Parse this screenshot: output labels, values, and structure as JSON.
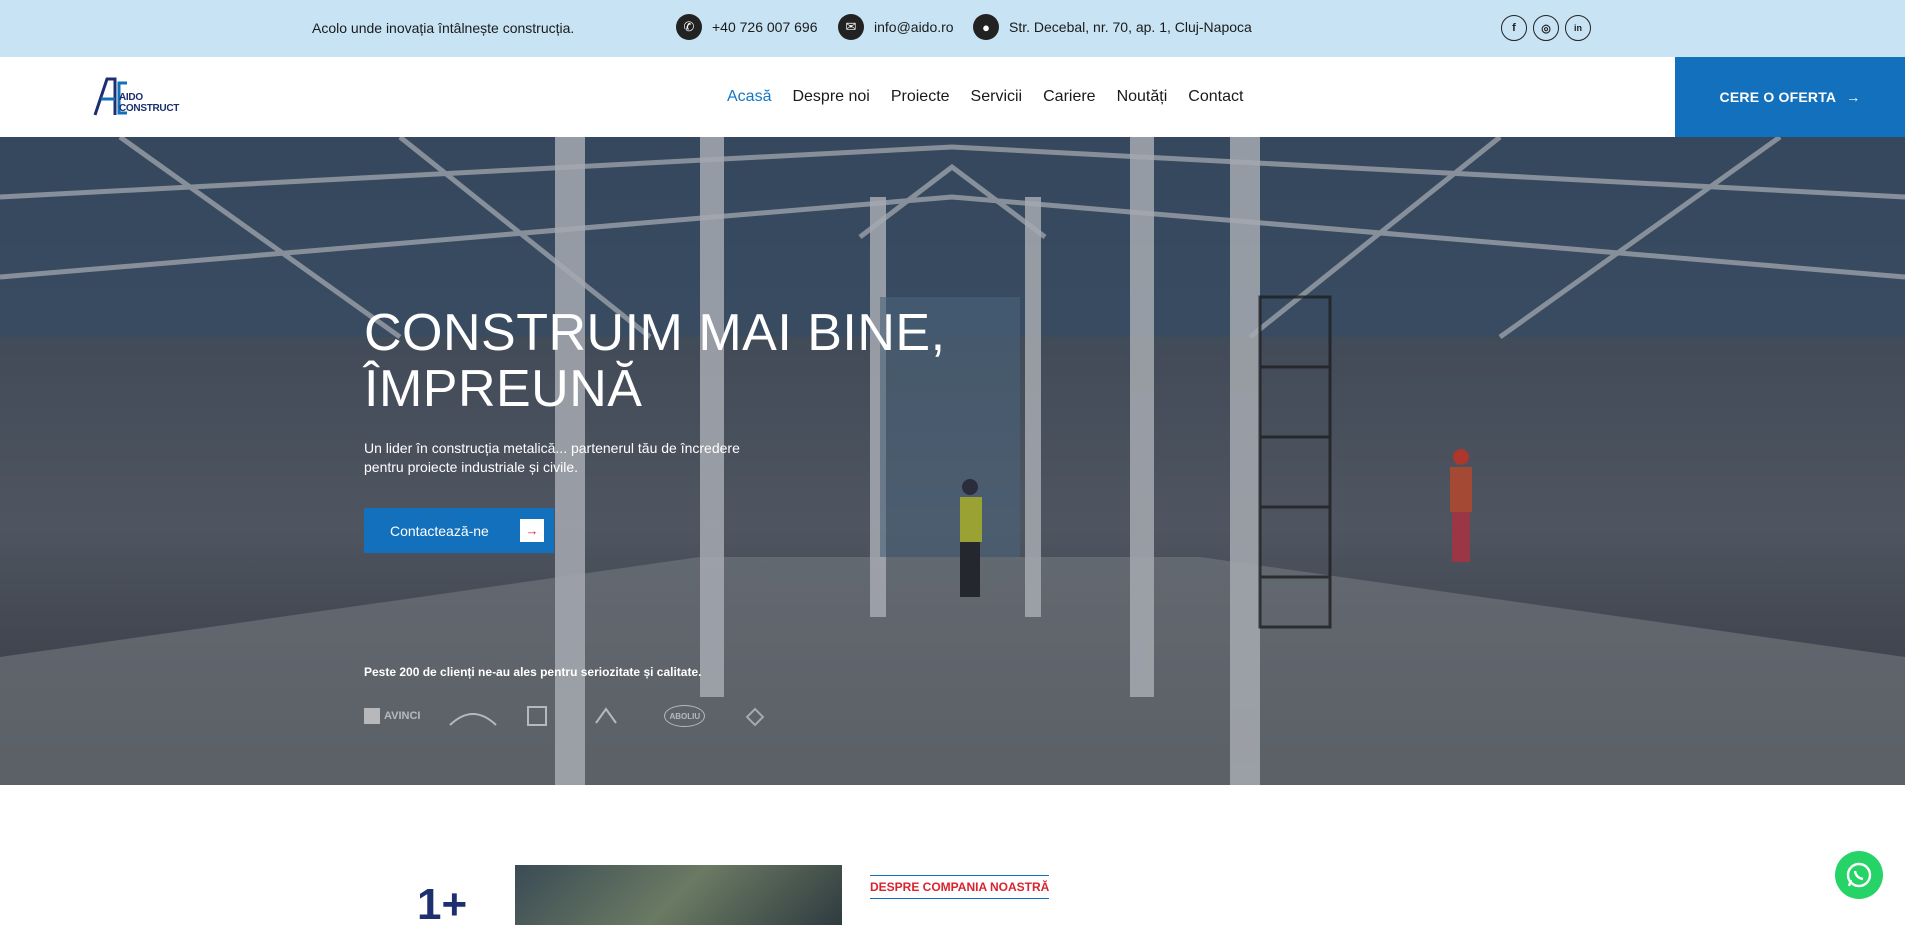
{
  "topbar": {
    "tagline": "Acolo unde inovația întâlnește construcția.",
    "phone": "+40 726 007 696",
    "email": "info@aido.ro",
    "address": "Str. Decebal, nr. 70, ap. 1, Cluj-Napoca",
    "social": [
      {
        "icon": "facebook-icon",
        "glyph": "f"
      },
      {
        "icon": "instagram-icon",
        "glyph": "◎"
      },
      {
        "icon": "linkedin-icon",
        "glyph": "in"
      }
    ]
  },
  "header": {
    "logo_text": "AIDO CONSTRUCT",
    "nav": [
      "Acasă",
      "Despre noi",
      "Proiecte",
      "Servicii",
      "Cariere",
      "Noutăți",
      "Contact"
    ],
    "active_nav": "Acasă",
    "cta_label": "CERE O OFERTA",
    "cta_arrow": "→"
  },
  "hero": {
    "title_line1": "CONSTRUIM MAI BINE,",
    "title_line2": "ÎMPREUNĂ",
    "subtitle": "Un lider în construcția metalică... partenerul tău de încredere pentru proiecte industriale și civile.",
    "button_label": "Contactează-ne",
    "button_arrow": "→",
    "clients_text": "Peste 200 de clienți ne-au ales pentru seriozitate și calitate.",
    "partners": [
      "AVINCI",
      "",
      "",
      "",
      "ABOLIU",
      ""
    ]
  },
  "about": {
    "counter": "1+",
    "section_label": "DESPRE COMPANIA NOASTRĂ"
  },
  "colors": {
    "topbar_bg": "#c7e3f4",
    "accent_blue": "#1270bd",
    "accent_red": "#d9232e",
    "whatsapp_green": "#25d366"
  }
}
